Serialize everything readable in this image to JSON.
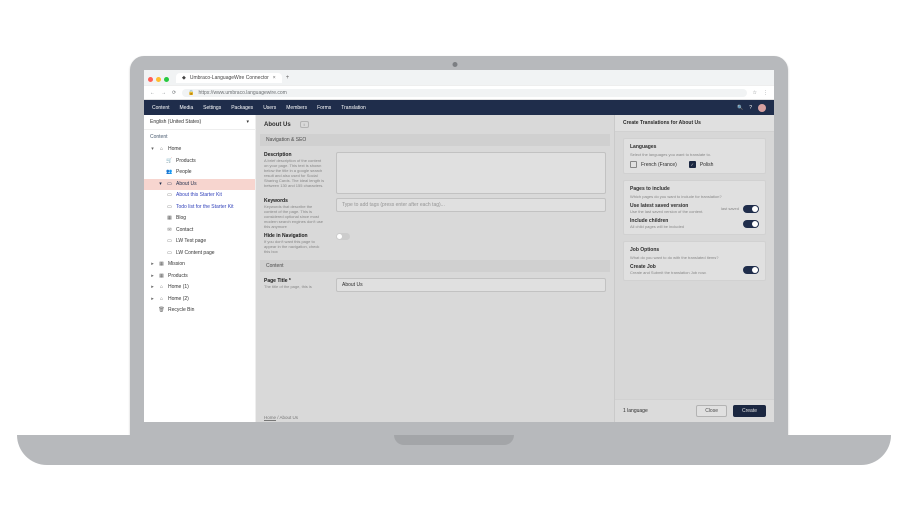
{
  "browser": {
    "tab_title": "Umbraco-LanguageWire Connector",
    "url_display": "https://www.umbraco.languagewire.com",
    "new_tab": "+",
    "tab_close": "×"
  },
  "nav": {
    "content": "Content",
    "media": "Media",
    "settings": "Settings",
    "packages": "Packages",
    "users": "Users",
    "members": "Members",
    "forms": "Forms",
    "translation": "Translation"
  },
  "sidebar": {
    "language": "English (United States)",
    "section": "Content",
    "tree": {
      "home": "Home",
      "products": "Products",
      "people": "People",
      "about_us": "About Us",
      "about_starter": "About this Starter Kit",
      "todo": "Todo list for the Starter Kit",
      "blog": "Blog",
      "contact": "Contact",
      "lw_test": "LW Test page",
      "lw_content": "LW Content page",
      "mission": "Mission",
      "products2": "Products",
      "home1": "Home (1)",
      "home2": "Home (2)",
      "recycle": "Recycle Bin"
    }
  },
  "editor": {
    "page_title": "About Us",
    "info_pill": "i",
    "sections": {
      "navseo": "Navigation & SEO",
      "content": "Content"
    },
    "description_label": "Description",
    "description_help": "A brief description of the content on your page. This text is shown below the title in a google search result and also used for Social Sharing Cards. The ideal length is between 130 and 155 characters.",
    "keywords_label": "Keywords",
    "keywords_placeholder": "Type to add tags (press enter after each tag)...",
    "keywords_help": "Keywords that describe the content of the page. This is considered optional since most modern search engines don't use this anymore",
    "hide_nav_label": "Hide in Navigation",
    "hide_nav_help": "If you don't want this page to appear in the navigation, check this box",
    "page_title_label": "Page Title *",
    "page_title_help": "The title of the page, this is",
    "page_title_value": "About Us",
    "breadcrumb_home": "Home",
    "breadcrumb_current": "About Us"
  },
  "panel": {
    "title": "Create Translations for About Us",
    "languages_header": "Languages",
    "languages_sub": "Select the languages you want to translate to.",
    "lang_fr": "French (France)",
    "lang_pl": "Polish",
    "pages_header": "Pages to include",
    "pages_sub": "Which pages do you want to include for translation?",
    "latest_saved_label": "Use latest saved version",
    "latest_saved_sub": "Use the last saved version of the content.",
    "latest_saved_badge": "last saved",
    "include_children_label": "Include children",
    "include_children_sub": "All child pages will be included",
    "job_options_header": "Job Options",
    "job_options_sub": "What do you want to do with the translated items?",
    "create_job_label": "Create Job",
    "create_job_sub": "Create and Submit the translation Job now.",
    "footer_left": "1 language",
    "close": "Close",
    "create": "Create"
  }
}
